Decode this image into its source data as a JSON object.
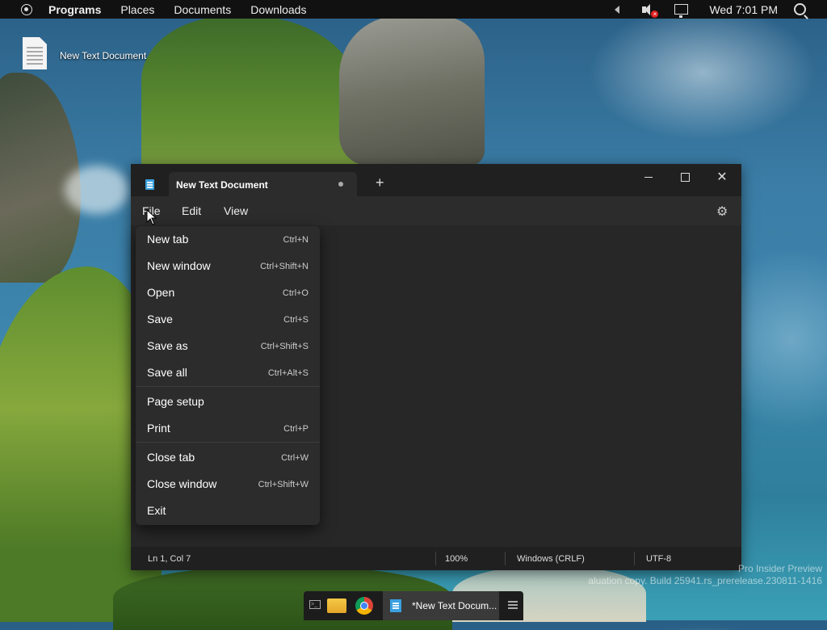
{
  "top_panel": {
    "menus": [
      "Programs",
      "Places",
      "Documents",
      "Downloads"
    ],
    "clock": "Wed 7:01 PM"
  },
  "desktop": {
    "icon_label": "New Text Document"
  },
  "notepad": {
    "tab_title": "New Text Document",
    "menubar": [
      "File",
      "Edit",
      "View"
    ],
    "status": {
      "position": "Ln 1, Col 7",
      "zoom": "100%",
      "line_ending": "Windows (CRLF)",
      "encoding": "UTF-8"
    }
  },
  "file_menu": {
    "items": [
      {
        "label": "New tab",
        "shortcut": "Ctrl+N"
      },
      {
        "label": "New window",
        "shortcut": "Ctrl+Shift+N"
      },
      {
        "label": "Open",
        "shortcut": "Ctrl+O"
      },
      {
        "label": "Save",
        "shortcut": "Ctrl+S"
      },
      {
        "label": "Save as",
        "shortcut": "Ctrl+Shift+S"
      },
      {
        "label": "Save all",
        "shortcut": "Ctrl+Alt+S"
      },
      {
        "label": "Page setup",
        "shortcut": ""
      },
      {
        "label": "Print",
        "shortcut": "Ctrl+P"
      },
      {
        "label": "Close tab",
        "shortcut": "Ctrl+W"
      },
      {
        "label": "Close window",
        "shortcut": "Ctrl+Shift+W"
      },
      {
        "label": "Exit",
        "shortcut": ""
      }
    ]
  },
  "watermark": {
    "line1": "Pro Insider Preview",
    "line2": "aluation copy. Build 25941.rs_prerelease.230811-1416"
  },
  "taskbar": {
    "notepad_label": "*New Text Docum..."
  },
  "colors": {
    "window_bg": "#272727",
    "titlebar_bg": "#202020",
    "menu_bg": "#2c2c2c",
    "accent": "#3aa0e0"
  }
}
